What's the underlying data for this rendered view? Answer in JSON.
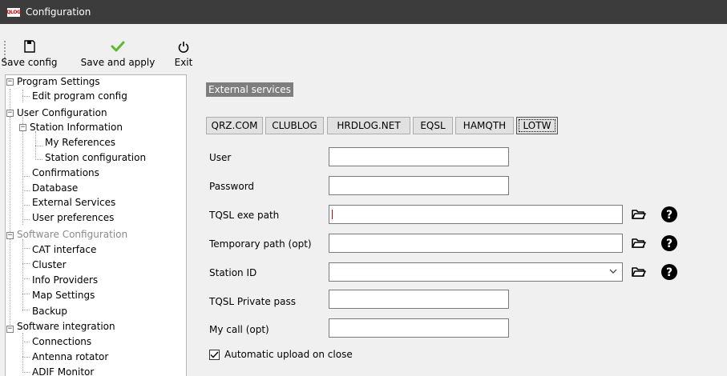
{
  "window": {
    "title": "Configuration",
    "app_icon_text": "QLOG"
  },
  "toolbar": {
    "save_config": "Save config",
    "save_apply": "Save and apply",
    "exit": "Exit"
  },
  "tree": {
    "program_settings": "Program Settings",
    "edit_program_config": "Edit program config",
    "user_configuration": "User Configuration",
    "station_information": "Station Information",
    "my_references": "My References",
    "station_configuration": "Station configuration",
    "confirmations": "Confirmations",
    "database": "Database",
    "external_services": "External Services",
    "user_preferences": "User preferences",
    "software_configuration": "Software Configuration",
    "cat_interface": "CAT interface",
    "cluster": "Cluster",
    "info_providers": "Info Providers",
    "map_settings": "Map Settings",
    "backup": "Backup",
    "software_integration": "Software integration",
    "connections": "Connections",
    "antenna_rotator": "Antenna rotator",
    "adif_monitor": "ADIF Monitor"
  },
  "panel": {
    "group_title": "External services",
    "tabs": [
      "QRZ.COM",
      "CLUBLOG",
      "HRDLOG.NET",
      "EQSL",
      "HAMQTH",
      "LOTW"
    ],
    "active_tab": "LOTW",
    "fields": {
      "user_label": "User",
      "user_value": "",
      "password_label": "Password",
      "password_value": "",
      "tqsl_path_label": "TQSL exe path",
      "tqsl_path_value": "",
      "temp_path_label": "Temporary path (opt)",
      "temp_path_value": "",
      "station_id_label": "Station ID",
      "station_id_value": "",
      "private_pass_label": "TQSL Private pass",
      "private_pass_value": "",
      "my_call_label": "My call (opt)",
      "my_call_value": ""
    },
    "auto_upload_label": "Automatic upload on close",
    "auto_upload_checked": true
  },
  "icons": {
    "save": "floppy-icon",
    "apply": "checkmark-icon",
    "exit": "power-icon",
    "folder": "folder-icon",
    "help": "help-icon"
  },
  "colors": {
    "titlebar": "#3c3c3c",
    "group_label_bg": "#7e7e7e",
    "apply_check": "#5cb82e"
  }
}
